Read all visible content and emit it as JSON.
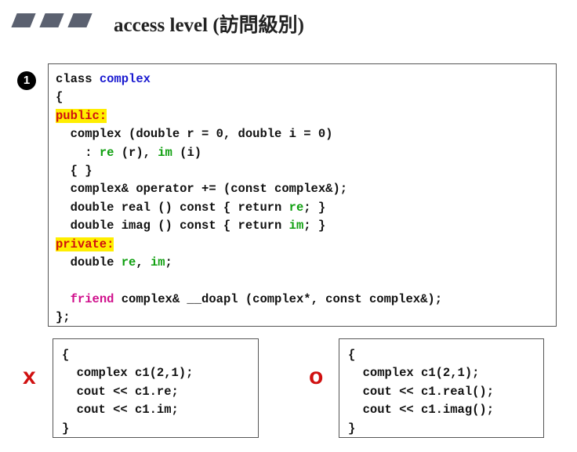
{
  "header": {
    "title": "access level (訪問級別)"
  },
  "badge": "1",
  "class_code": {
    "lines": [
      [
        {
          "t": "class ",
          "s": "plain"
        },
        {
          "t": "complex",
          "s": "blue"
        }
      ],
      [
        {
          "t": "{",
          "s": "plain"
        }
      ],
      [
        {
          "t": "public:",
          "s": "access"
        }
      ],
      [
        {
          "t": "  complex (double r = 0, double i = 0)",
          "s": "plain"
        }
      ],
      [
        {
          "t": "    : ",
          "s": "plain"
        },
        {
          "t": "re",
          "s": "green"
        },
        {
          "t": " (r), ",
          "s": "plain"
        },
        {
          "t": "im",
          "s": "green"
        },
        {
          "t": " (i)",
          "s": "plain"
        }
      ],
      [
        {
          "t": "  { }",
          "s": "plain"
        }
      ],
      [
        {
          "t": "  complex& operator += (const complex&);",
          "s": "plain"
        }
      ],
      [
        {
          "t": "  double real () const { return ",
          "s": "plain"
        },
        {
          "t": "re",
          "s": "green"
        },
        {
          "t": "; }",
          "s": "plain"
        }
      ],
      [
        {
          "t": "  double imag () const { return ",
          "s": "plain"
        },
        {
          "t": "im",
          "s": "green"
        },
        {
          "t": "; }",
          "s": "plain"
        }
      ],
      [
        {
          "t": "private:",
          "s": "access"
        }
      ],
      [
        {
          "t": "  double ",
          "s": "plain"
        },
        {
          "t": "re",
          "s": "green"
        },
        {
          "t": ", ",
          "s": "plain"
        },
        {
          "t": "im",
          "s": "green"
        },
        {
          "t": ";",
          "s": "plain"
        }
      ],
      [
        {
          "t": "",
          "s": "plain"
        }
      ],
      [
        {
          "t": "  ",
          "s": "plain"
        },
        {
          "t": "friend",
          "s": "magenta"
        },
        {
          "t": " complex& __doapl (complex*, const complex&);",
          "s": "plain"
        }
      ],
      [
        {
          "t": "};",
          "s": "plain"
        }
      ]
    ]
  },
  "examples": {
    "wrong": {
      "mark": "x",
      "lines": [
        "{",
        "  complex c1(2,1);",
        "  cout << c1.re;",
        "  cout << c1.im;",
        "}"
      ]
    },
    "right": {
      "mark": "o",
      "lines": [
        "{",
        "  complex c1(2,1);",
        "  cout << c1.real();",
        "  cout << c1.imag();",
        "}"
      ]
    }
  },
  "colors": {
    "keyword_blue": "#1a1ad0",
    "member_green": "#10a010",
    "friend_magenta": "#d0108c",
    "access_red": "#d01010",
    "highlight_yellow": "#ffee00",
    "mark_red": "#d01010"
  }
}
